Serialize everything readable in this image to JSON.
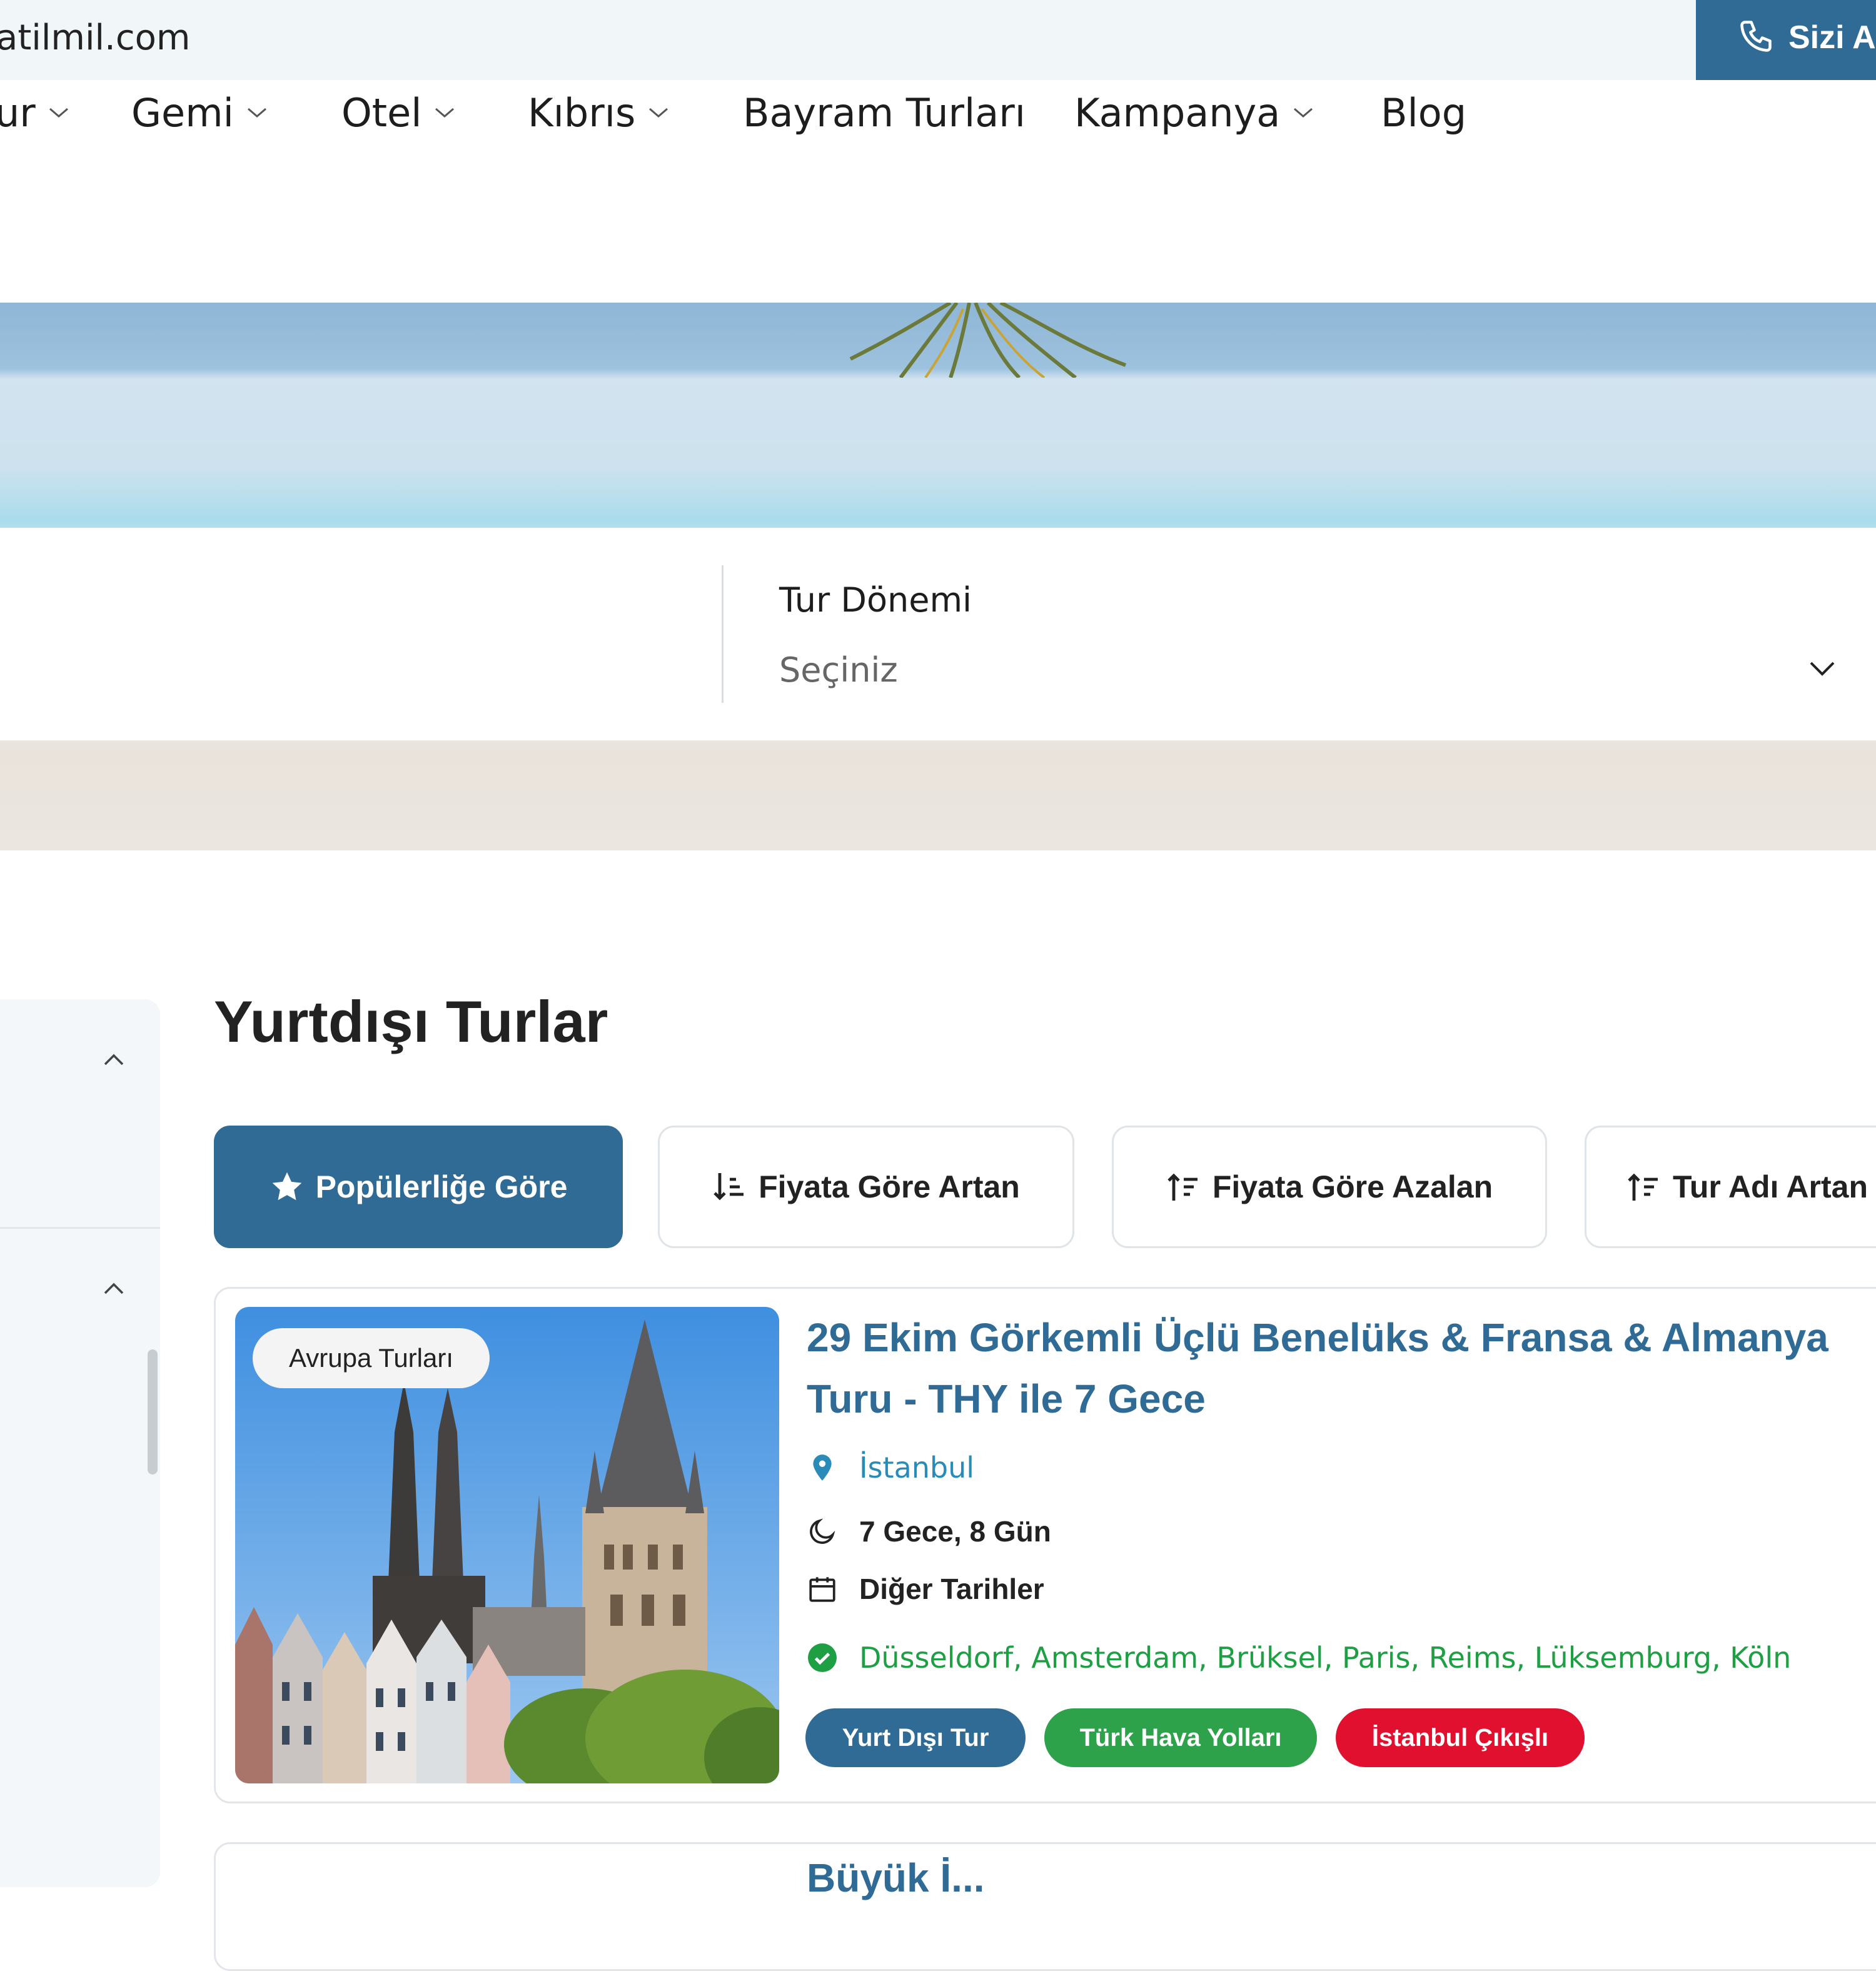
{
  "topbar": {
    "email_fragment": "atilmil.com",
    "call_label": "Sizi Ar"
  },
  "nav": {
    "items": [
      {
        "label": "ur",
        "has_dropdown": true
      },
      {
        "label": "Gemi",
        "has_dropdown": true
      },
      {
        "label": "Otel",
        "has_dropdown": true
      },
      {
        "label": "Kıbrıs",
        "has_dropdown": true
      },
      {
        "label": "Bayram Turları",
        "has_dropdown": false
      },
      {
        "label": "Kampanya",
        "has_dropdown": true
      },
      {
        "label": "Blog",
        "has_dropdown": false
      }
    ]
  },
  "search": {
    "period_label": "Tur Dönemi",
    "period_value": "Seçiniz"
  },
  "main": {
    "title": "Yurtdışı Turlar",
    "sort": [
      {
        "label": "Popülerliğe Göre",
        "icon": "star-icon",
        "active": true
      },
      {
        "label": "Fiyata Göre Artan",
        "icon": "sort-ascending-icon",
        "active": false
      },
      {
        "label": "Fiyata Göre Azalan",
        "icon": "sort-descending-icon",
        "active": false
      },
      {
        "label": "Tur Adı Artan",
        "icon": "sort-alpha-icon",
        "active": false
      }
    ]
  },
  "tours": [
    {
      "category": "Avrupa Turları",
      "title": "29 Ekim Görkemli Üçlü Benelüks & Fransa & Almanya Turu - THY ile 7 Gece",
      "city": "İstanbul",
      "duration": "7 Gece, 8 Gün",
      "dates": "Diğer Tarihler",
      "route": "Düsseldorf, Amsterdam, Brüksel, Paris, Reims, Lüksemburg, Köln",
      "badges": [
        {
          "label": "Yurt Dışı Tur",
          "color": "#2f6b95"
        },
        {
          "label": "Türk Hava Yolları",
          "color": "#2ea24a"
        },
        {
          "label": "İstanbul Çıkışlı",
          "color": "#e0102e"
        }
      ]
    },
    {
      "title_fragment": "Büyük İ..."
    }
  ],
  "colors": {
    "primary": "#2f6b95",
    "green": "#2ea24a",
    "red": "#e0102e",
    "link": "#2a8bb8"
  }
}
